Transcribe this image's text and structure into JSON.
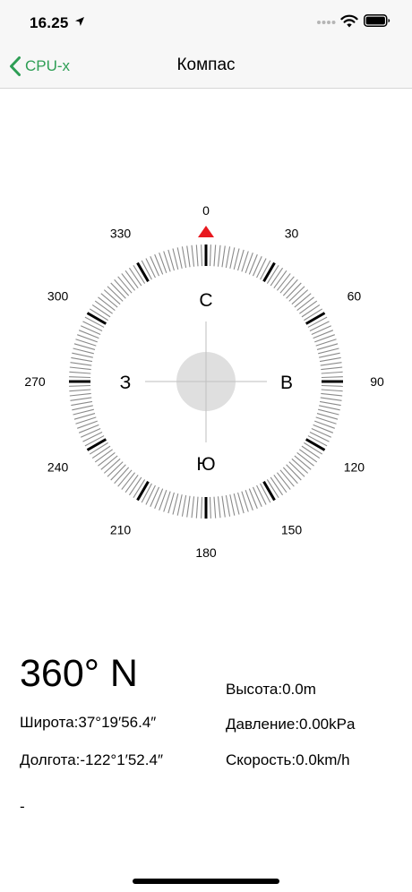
{
  "status_bar": {
    "time": "16.25",
    "icons": [
      "location-arrow-icon",
      "cellular-dots-icon",
      "wifi-icon",
      "battery-icon"
    ]
  },
  "nav": {
    "back_label": "CPU-x",
    "title": "Компас",
    "accent_color": "#2e9e55"
  },
  "compass": {
    "degree_labels": [
      "0",
      "30",
      "60",
      "90",
      "120",
      "150",
      "180",
      "210",
      "240",
      "270",
      "300",
      "330"
    ],
    "cardinals": {
      "north": "С",
      "east": "В",
      "south": "Ю",
      "west": "З"
    },
    "indicator_color": "#e8191f"
  },
  "readings": {
    "heading": "360° N",
    "latitude": "Широта:37°19′56.4″",
    "longitude": "Долгота:-122°1′52.4″",
    "altitude": "Высота:0.0m",
    "pressure": "Давление:0.00kPa",
    "speed": "Скорость:0.0km/h",
    "extra": "-"
  }
}
